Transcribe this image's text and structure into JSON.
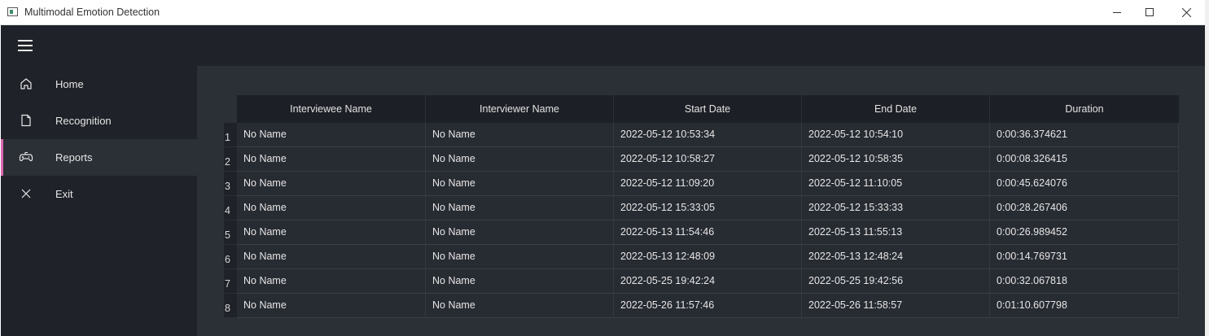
{
  "window": {
    "title": "Multimodal Emotion Detection",
    "controls": {
      "minimize": "─",
      "maximize": "☐",
      "close": "✕"
    }
  },
  "sidebar": {
    "menu_icon": "hamburger-icon",
    "items": [
      {
        "label": "Home",
        "icon": "home-icon"
      },
      {
        "label": "Recognition",
        "icon": "document-icon"
      },
      {
        "label": "Reports",
        "icon": "gamepad-icon",
        "active": true
      },
      {
        "label": "Exit",
        "icon": "close-icon"
      }
    ]
  },
  "table": {
    "columns": [
      "Interviewee Name",
      "Interviewer Name",
      "Start Date",
      "End Date",
      "Duration"
    ],
    "rows": [
      {
        "num": "1",
        "cells": [
          "No Name",
          "No Name",
          "2022-05-12 10:53:34",
          "2022-05-12 10:54:10",
          "0:00:36.374621"
        ]
      },
      {
        "num": "2",
        "cells": [
          "No Name",
          "No Name",
          "2022-05-12 10:58:27",
          "2022-05-12 10:58:35",
          "0:00:08.326415"
        ]
      },
      {
        "num": "3",
        "cells": [
          "No Name",
          "No Name",
          "2022-05-12 11:09:20",
          "2022-05-12 11:10:05",
          "0:00:45.624076"
        ]
      },
      {
        "num": "4",
        "cells": [
          "No Name",
          "No Name",
          "2022-05-12 15:33:05",
          "2022-05-12 15:33:33",
          "0:00:28.267406"
        ]
      },
      {
        "num": "5",
        "cells": [
          "No Name",
          "No Name",
          "2022-05-13 11:54:46",
          "2022-05-13 11:55:13",
          "0:00:26.989452"
        ]
      },
      {
        "num": "6",
        "cells": [
          "No Name",
          "No Name",
          "2022-05-13 12:48:09",
          "2022-05-13 12:48:24",
          "0:00:14.769731"
        ]
      },
      {
        "num": "7",
        "cells": [
          "No Name",
          "No Name",
          "2022-05-25 19:42:24",
          "2022-05-25 19:42:56",
          "0:00:32.067818"
        ]
      },
      {
        "num": "8",
        "cells": [
          "No Name",
          "No Name",
          "2022-05-26 11:57:46",
          "2022-05-26 11:58:57",
          "0:01:10.607798"
        ]
      }
    ]
  },
  "colors": {
    "accent": "#d86ab0",
    "sidebar_bg": "#1f2228",
    "content_bg": "#2b2f36"
  }
}
